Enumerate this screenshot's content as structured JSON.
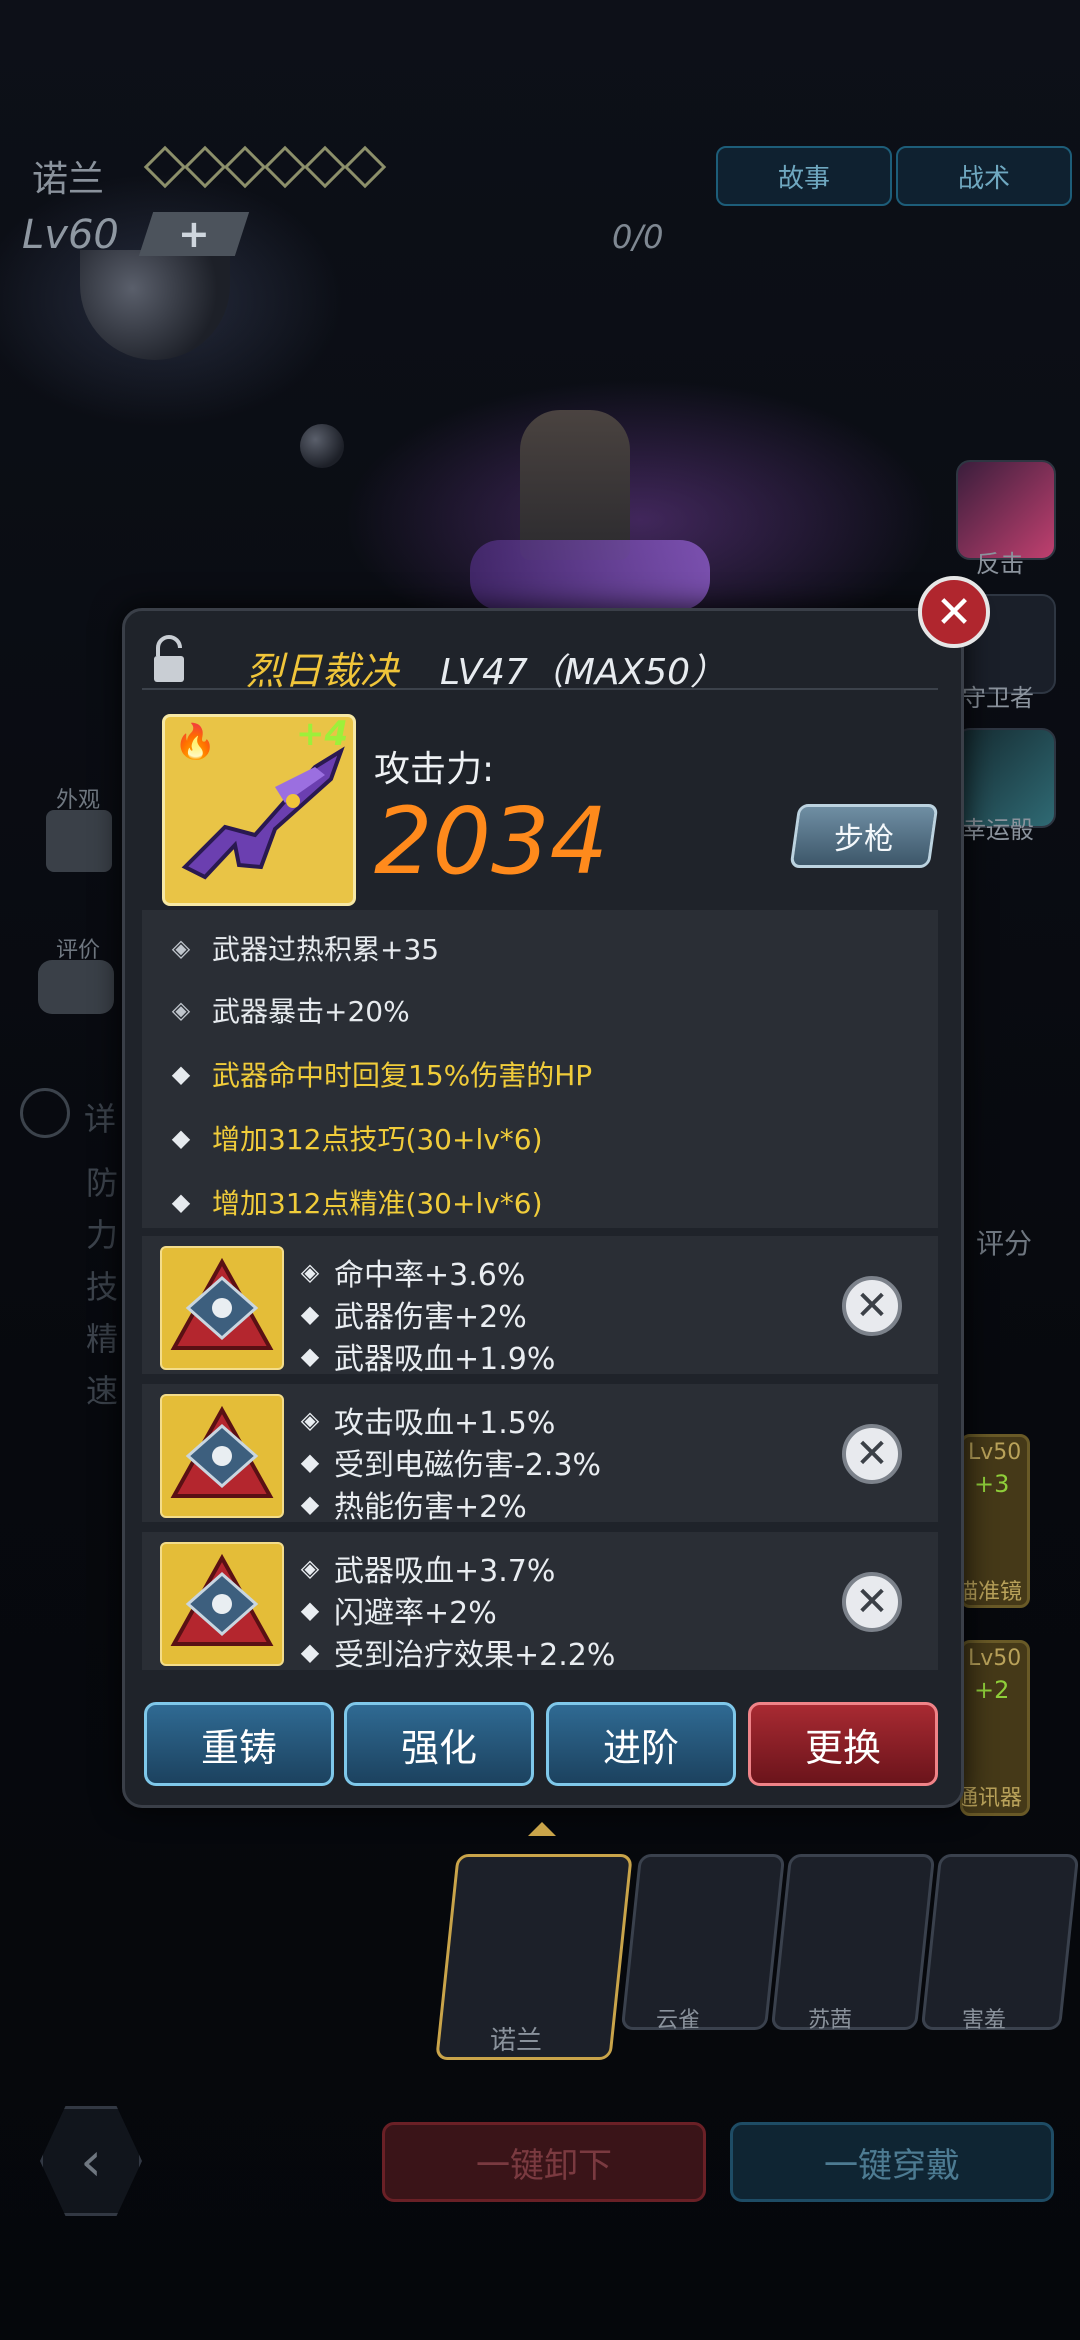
{
  "header": {
    "hero_name": "诺兰",
    "level": "Lv60",
    "plus": "+",
    "progress": "0/0",
    "tabs": [
      "故事",
      "战术"
    ]
  },
  "side_right": {
    "items": [
      "反击",
      "守卫者",
      "幸运骰"
    ]
  },
  "side_left": {
    "items": [
      "外观",
      "评价"
    ],
    "details_label": "详",
    "details_rows": [
      "防",
      "力",
      "技",
      "精",
      "速"
    ]
  },
  "score_label": "评分",
  "modal": {
    "weapon_name": "烈日裁决",
    "weapon_level": "LV47（MAX50）",
    "enhance": "+4",
    "attack_label": "攻击力:",
    "attack_value": "2034",
    "weapon_type": "步枪",
    "stats": [
      {
        "text": "武器过热积累+35",
        "color": "#e6eaee",
        "marker": "gear"
      },
      {
        "text": "武器暴击+20%",
        "color": "#e6eaee",
        "marker": "gear"
      },
      {
        "text": "武器命中时回复15%伤害的HP",
        "color": "#f0cc3a",
        "marker": "diamond"
      },
      {
        "text": "增加312点技巧(30+lv*6)",
        "color": "#f0cc3a",
        "marker": "diamond"
      },
      {
        "text": "增加312点精准(30+lv*6)",
        "color": "#f0cc3a",
        "marker": "diamond"
      }
    ],
    "gems": [
      {
        "stats": [
          "命中率+3.6%",
          "武器伤害+2%",
          "武器吸血+1.9%"
        ]
      },
      {
        "stats": [
          "攻击吸血+1.5%",
          "受到电磁伤害-2.3%",
          "热能伤害+2%"
        ]
      },
      {
        "stats": [
          "武器吸血+3.7%",
          "闪避率+2%",
          "受到治疗效果+2.2%"
        ]
      }
    ],
    "actions": [
      "重铸",
      "强化",
      "进阶",
      "更换"
    ]
  },
  "behind_cards": [
    {
      "level": "Lv50",
      "plus": "+3",
      "label": "瞄准镜"
    },
    {
      "level": "Lv50",
      "plus": "+2",
      "label": "通讯器"
    }
  ],
  "heroes": [
    "诺兰",
    "云雀",
    "苏茜",
    "害羞"
  ],
  "bottom": {
    "unequip_all": "一键卸下",
    "equip_all": "一键穿戴"
  },
  "colors": {
    "accent_gold": "#f0c53a",
    "attack_orange": "#ff8a1c",
    "action_blue": "#2f6a93",
    "action_red": "#a82a32"
  }
}
